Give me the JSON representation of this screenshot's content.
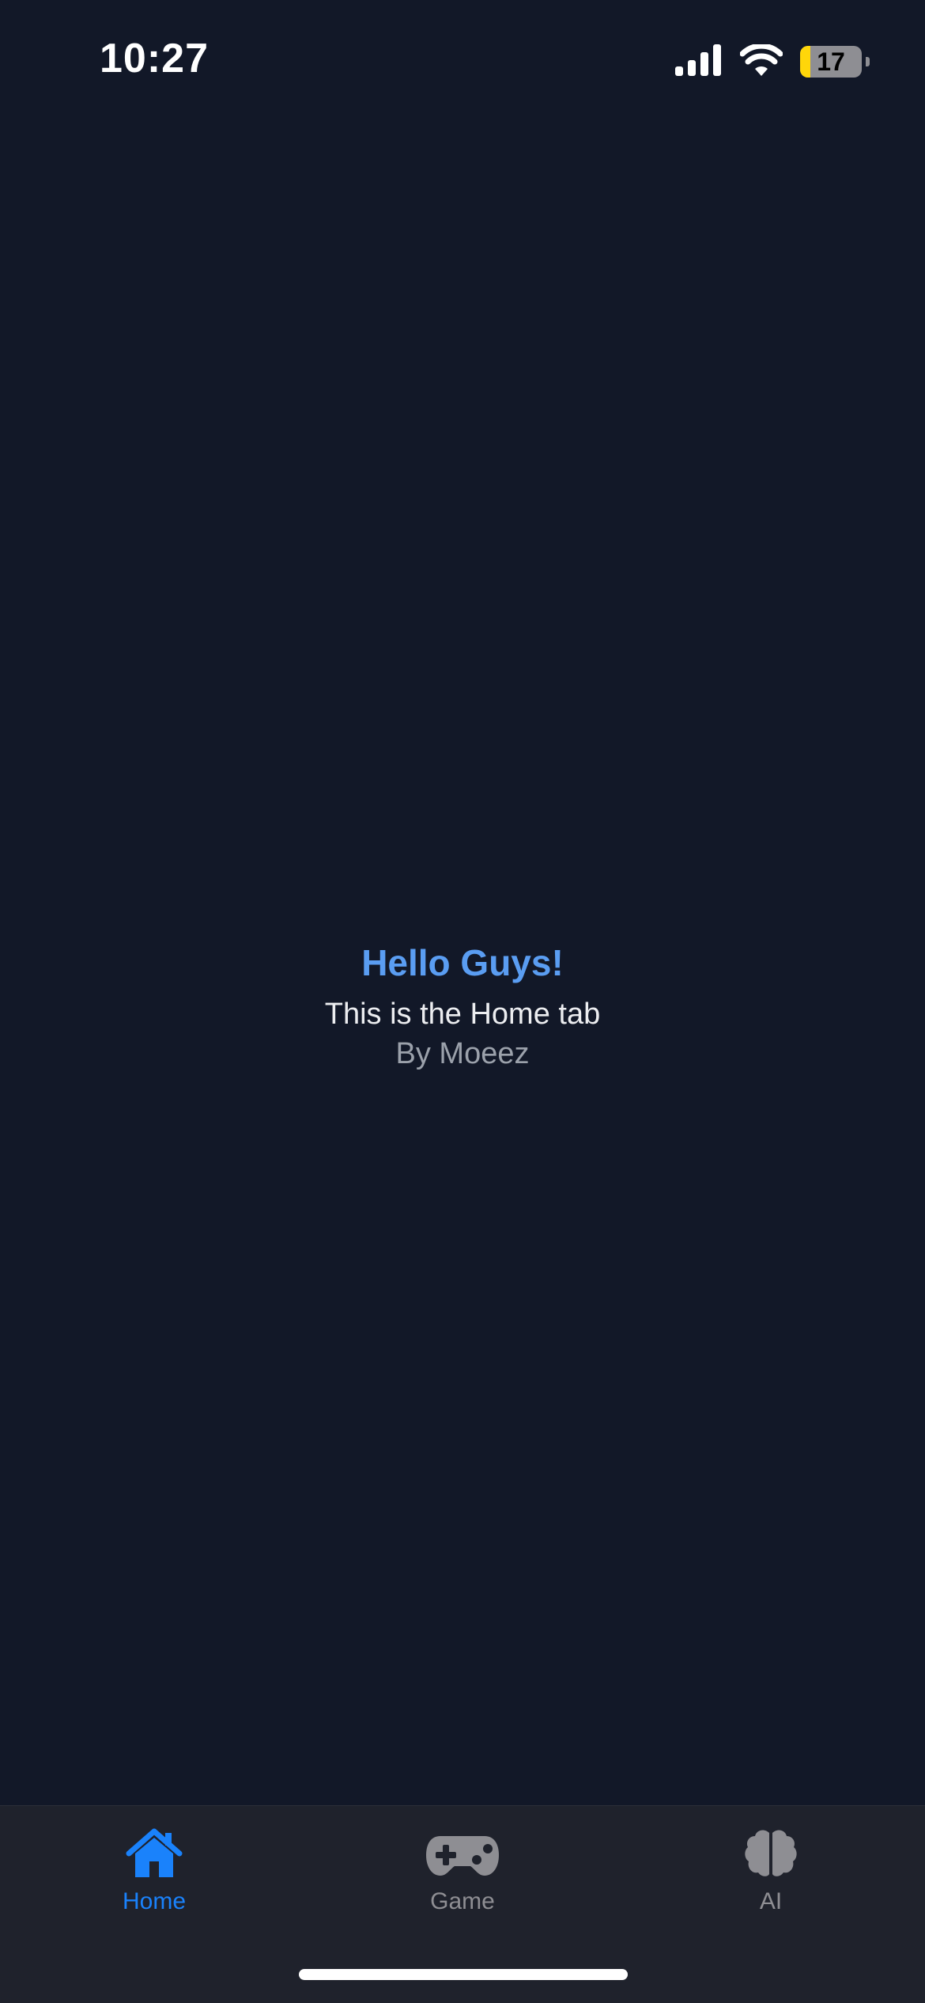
{
  "status_bar": {
    "time": "10:27",
    "battery_level": "17",
    "battery_fraction": 0.17
  },
  "content": {
    "title": "Hello Guys!",
    "subtitle": "This is the Home tab",
    "author": "By Moeez"
  },
  "tab_bar": {
    "tabs": [
      {
        "label": "Home",
        "icon": "home-icon",
        "active": true
      },
      {
        "label": "Game",
        "icon": "gamepad-icon",
        "active": false
      },
      {
        "label": "AI",
        "icon": "brain-icon",
        "active": false
      }
    ],
    "active_color": "#1a82fb",
    "inactive_color": "#8e8e93"
  },
  "colors": {
    "background": "#121828",
    "title": "#5a9df2",
    "tab_bar_background": "#1f222c"
  }
}
